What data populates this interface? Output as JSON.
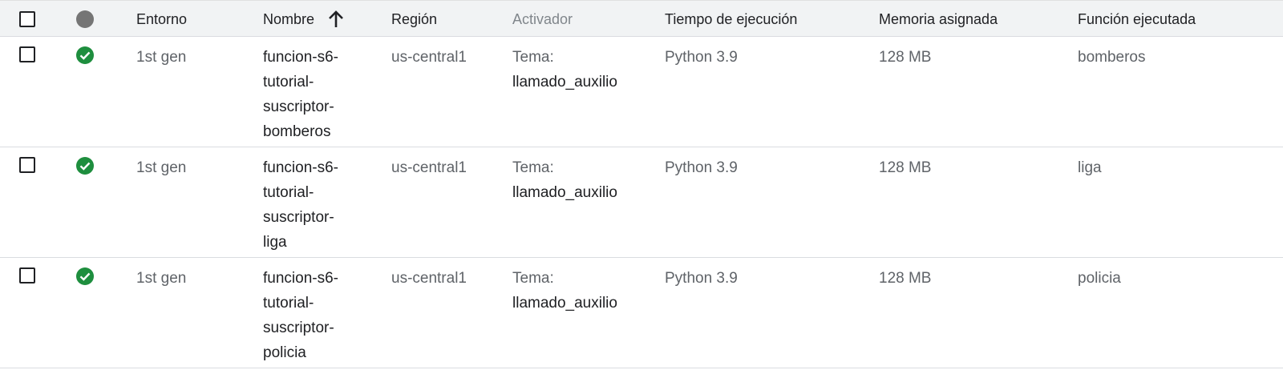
{
  "header": {
    "select_all_label": "",
    "columns": {
      "entorno": "Entorno",
      "nombre": "Nombre",
      "region": "Región",
      "activador": "Activador",
      "tiempo": "Tiempo de ejecución",
      "memoria": "Memoria asignada",
      "funcion": "Función ejecutada"
    },
    "sort_icon": "arrow-up-icon",
    "status_icon": "status-dot-icon"
  },
  "rows": [
    {
      "status_icon": "check-circle-icon",
      "entorno": "1st gen",
      "nombre_lines": [
        "funcion-s6-",
        "tutorial-",
        "suscriptor-",
        "bomberos"
      ],
      "region": "us-central1",
      "activador_label": "Tema:",
      "activador_value": "llamado_auxilio",
      "tiempo": "Python 3.9",
      "memoria": "128 MB",
      "funcion": "bomberos"
    },
    {
      "status_icon": "check-circle-icon",
      "entorno": "1st gen",
      "nombre_lines": [
        "funcion-s6-",
        "tutorial-",
        "suscriptor-",
        "liga"
      ],
      "region": "us-central1",
      "activador_label": "Tema:",
      "activador_value": "llamado_auxilio",
      "tiempo": "Python 3.9",
      "memoria": "128 MB",
      "funcion": "liga"
    },
    {
      "status_icon": "check-circle-icon",
      "entorno": "1st gen",
      "nombre_lines": [
        "funcion-s6-",
        "tutorial-",
        "suscriptor-",
        "policia"
      ],
      "region": "us-central1",
      "activador_label": "Tema:",
      "activador_value": "llamado_auxilio",
      "tiempo": "Python 3.9",
      "memoria": "128 MB",
      "funcion": "policia"
    }
  ],
  "colors": {
    "header_bg": "#f1f3f4",
    "ok_green": "#1e8e3e",
    "status_gray": "#757575",
    "divider": "#dadce0"
  }
}
